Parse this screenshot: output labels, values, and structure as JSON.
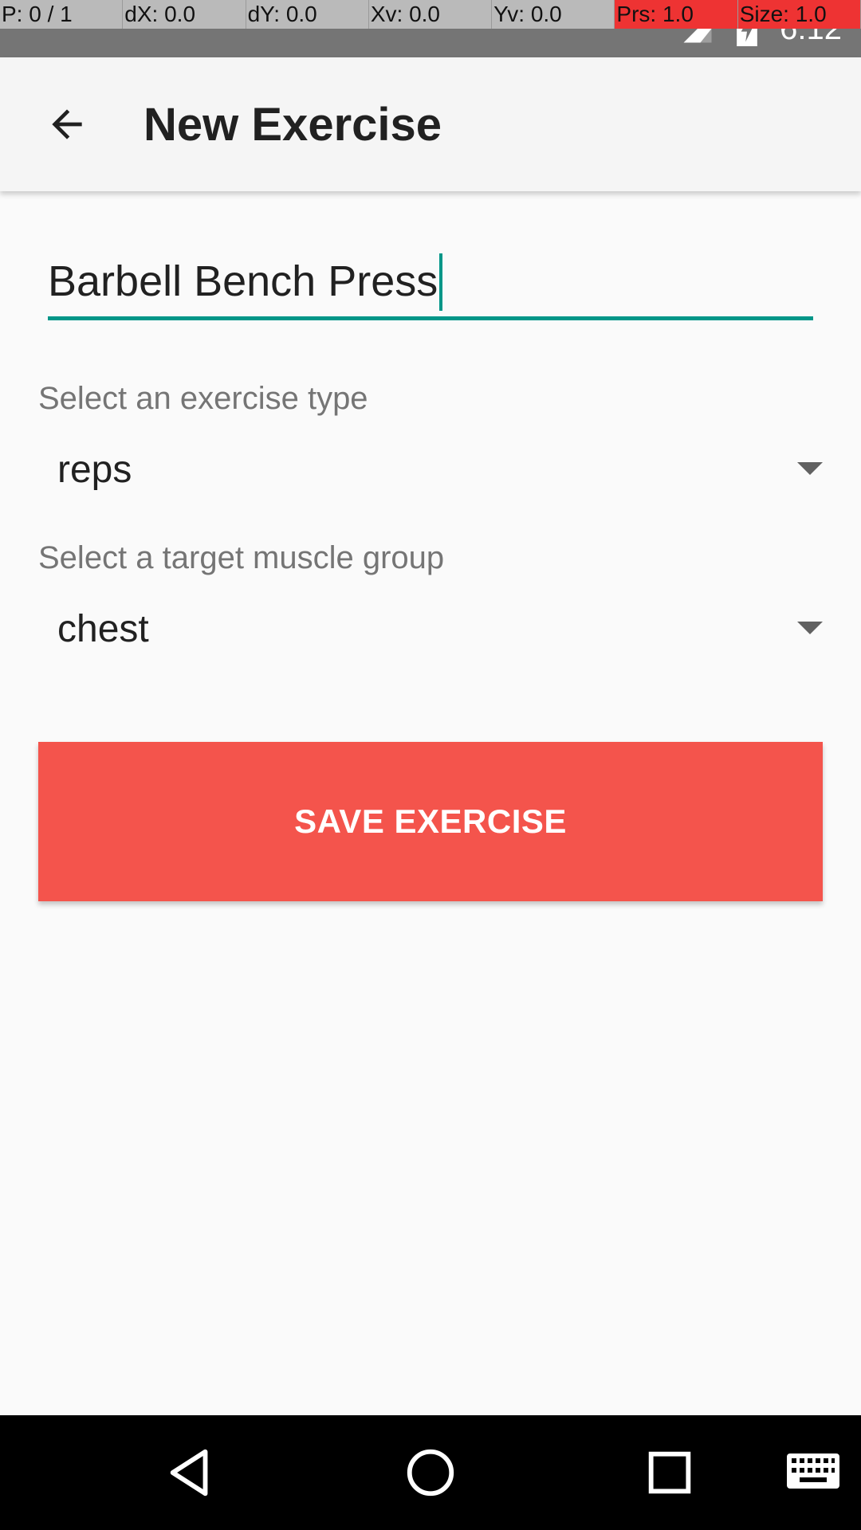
{
  "pointer_overlay": {
    "cells": [
      {
        "text": "P: 0 / 1"
      },
      {
        "text": "dX: 0.0"
      },
      {
        "text": "dY: 0.0"
      },
      {
        "text": "Xv: 0.0"
      },
      {
        "text": "Yv: 0.0"
      },
      {
        "text": "Prs: 1.0"
      },
      {
        "text": "Size: 1.0"
      }
    ]
  },
  "status_bar": {
    "time": "6:12",
    "icons": [
      "cell-signal-icon",
      "battery-charging-icon"
    ]
  },
  "app_bar": {
    "title": "New Exercise",
    "back_icon": "arrow-back-icon"
  },
  "form": {
    "exercise_name": {
      "value": "Barbell Bench Press",
      "underline_color": "#009688"
    },
    "exercise_type": {
      "label": "Select an exercise type",
      "selected": "reps"
    },
    "muscle_group": {
      "label": "Select a target muscle group",
      "selected": "chest"
    },
    "save_button": {
      "label": "SAVE EXERCISE",
      "color": "#f4544c"
    }
  },
  "nav_bar": {
    "icons": [
      "nav-back-icon",
      "nav-home-icon",
      "nav-recents-icon",
      "keyboard-icon"
    ]
  }
}
